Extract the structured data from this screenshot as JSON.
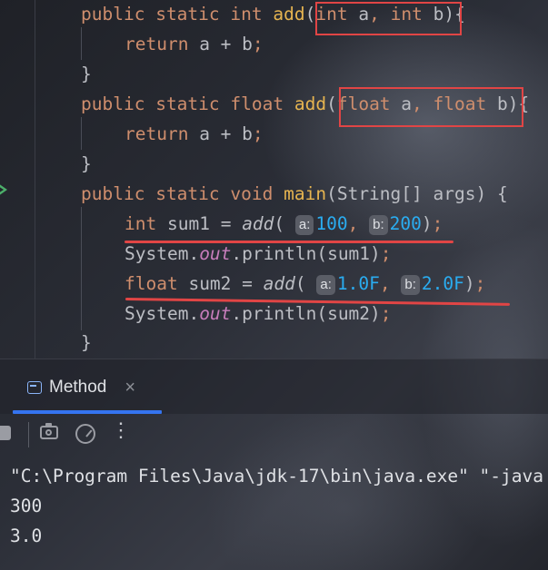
{
  "editor": {
    "kw_public": "public",
    "kw_static": "static",
    "kw_int": "int",
    "kw_float": "float",
    "kw_void": "void",
    "kw_return": "return",
    "fn_add": "add",
    "fn_main": "main",
    "param_a": "a",
    "param_b": "b",
    "string_args": "(String[] args)",
    "return_expr": "a + b",
    "var_sum1": "sum1",
    "var_sum2": "sum2",
    "system": "System.",
    "out": "out",
    "println1": ".println(sum1)",
    "println2": ".println(sum2)",
    "hint_a": "a:",
    "hint_b": "b:",
    "arg_100": "100",
    "arg_200": "200",
    "arg_1f": "1.0F",
    "arg_2f": "2.0F",
    "brace_close": "}",
    "brace_open": "{"
  },
  "panel": {
    "tab_label": "Method",
    "tab_close": "×",
    "more": "⋮"
  },
  "console": {
    "lines": [
      "\"C:\\Program Files\\Java\\jdk-17\\bin\\java.exe\" \"-java",
      "300",
      "3.0"
    ]
  },
  "colors": {
    "keyword": "#cf8e6d",
    "function": "#e6b450",
    "number": "#2aacf0",
    "field": "#c77dbb",
    "annotation_red": "#e14545",
    "tab_accent": "#3574f0"
  },
  "icons": [
    "run-gutter-icon",
    "method-tab-icon",
    "close-icon",
    "stop-icon",
    "camera-icon",
    "gauge-icon",
    "more-options-icon"
  ]
}
